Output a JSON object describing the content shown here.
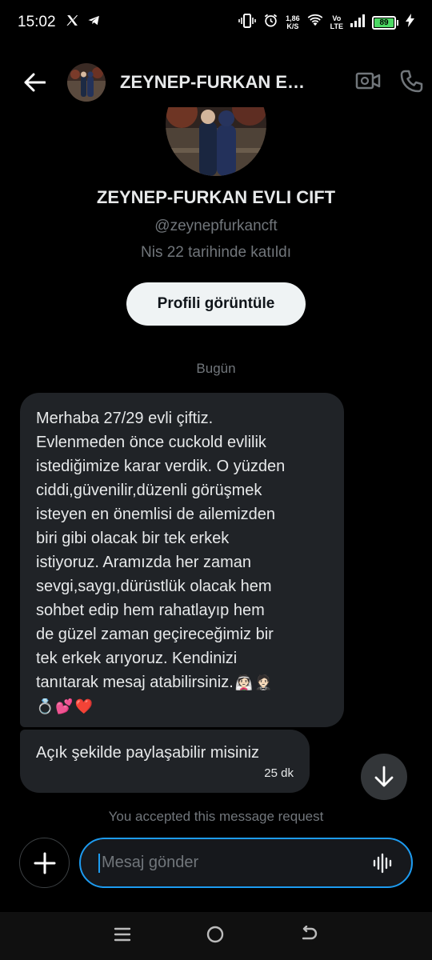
{
  "status_bar": {
    "time": "15:02",
    "left_icons": [
      "x-logo-icon",
      "telegram-icon"
    ],
    "net_speed_value": "1,86",
    "net_speed_unit": "K/S",
    "volte_top": "Vo",
    "volte_bottom": "LTE",
    "battery_level": "89",
    "battery_color": "#4cd964"
  },
  "header": {
    "title": "ZEYNEP-FURKAN EVLI CIFT"
  },
  "profile": {
    "name": "ZEYNEP-FURKAN EVLI CIFT",
    "handle": "@zeynepfurkancft",
    "joined": "Nis 22 tarihinde katıldı",
    "view_profile_label": "Profili görüntüle"
  },
  "date_separator": "Bugün",
  "messages": [
    {
      "lines": [
        "Merhaba 27/29 evli çiftiz.",
        "Evlenmeden önce cuckold evlilik",
        "istediğimize karar verdik. O yüzden",
        "ciddi,güvenilir,düzenli görüşmek",
        "isteyen en önemlisi de ailemizden",
        "biri gibi olacak bir tek erkek",
        "istiyoruz. Aramızda her zaman",
        "sevgi,saygı,dürüstlük olacak hem",
        "sohbet edip hem rahatlayıp hem",
        "de güzel zaman geçireceğimiz bir",
        "tek erkek arıyoruz. Kendinizi",
        "tanıtarak mesaj atabilirsiniz."
      ],
      "emojis": [
        "👰🏻",
        "🤵🏻",
        "💍",
        "💕",
        "❤️"
      ]
    },
    {
      "text": "Açık şekilde paylaşabilir misiniz",
      "time": "25 dk"
    }
  ],
  "accepted_note": "You accepted this message request",
  "composer": {
    "placeholder": "Mesaj gönder"
  },
  "colors": {
    "accent": "#1d9bf0",
    "bubble": "#202327",
    "muted_text": "#71767b"
  }
}
